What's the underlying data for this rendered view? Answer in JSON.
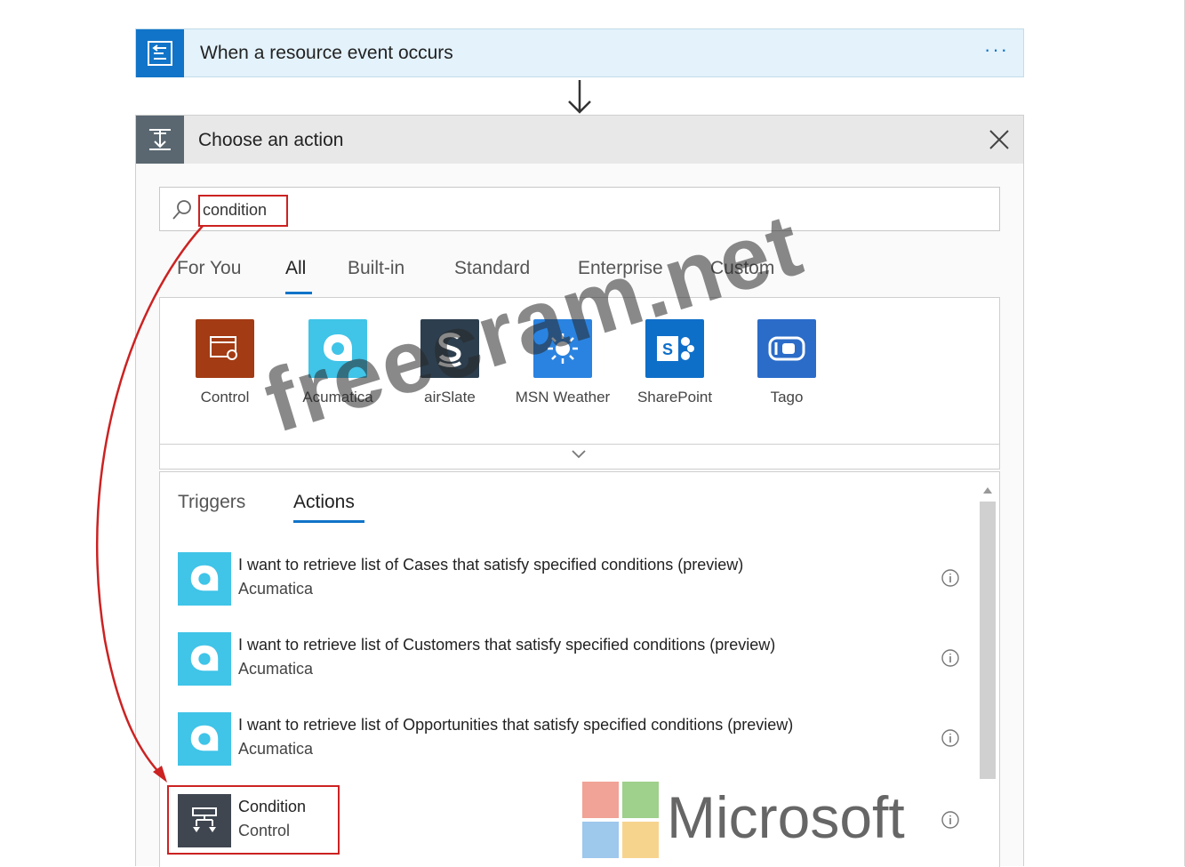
{
  "trigger": {
    "title": "When a resource event occurs",
    "more": "···"
  },
  "action_picker": {
    "title": "Choose an action",
    "search": {
      "value": "condition",
      "placeholder": ""
    },
    "category_tabs": [
      "For You",
      "All",
      "Built-in",
      "Standard",
      "Enterprise",
      "Custom"
    ],
    "active_category": "All",
    "connectors": [
      {
        "label": "Control",
        "color": "#a33b14",
        "icon": "control-icon"
      },
      {
        "label": "Acumatica",
        "color": "#40c4e8",
        "icon": "acumatica-icon"
      },
      {
        "label": "airSlate",
        "color": "#2d3f4e",
        "icon": "airslate-icon"
      },
      {
        "label": "MSN Weather",
        "color": "#2a83e0",
        "icon": "sun-icon"
      },
      {
        "label": "SharePoint",
        "color": "#0e6fc9",
        "icon": "sharepoint-icon"
      },
      {
        "label": "Tago",
        "color": "#2b6cc9",
        "icon": "tago-icon"
      }
    ],
    "result_tabs": [
      "Triggers",
      "Actions"
    ],
    "active_result_tab": "Actions",
    "results": [
      {
        "name": "I want to retrieve list of Cases that satisfy specified conditions (preview)",
        "connector": "Acumatica",
        "color": "#40c4e8"
      },
      {
        "name": "I want to retrieve list of Customers that satisfy specified conditions (preview)",
        "connector": "Acumatica",
        "color": "#40c4e8"
      },
      {
        "name": "I want to retrieve list of Opportunities that satisfy specified conditions (preview)",
        "connector": "Acumatica",
        "color": "#40c4e8"
      },
      {
        "name": "Condition",
        "connector": "Control",
        "color": "#3f4650"
      }
    ]
  },
  "overlays": {
    "watermark": "freecram.net",
    "microsoft": "Microsoft"
  },
  "colors": {
    "accent": "#1174c8",
    "highlight": "#cc2222"
  }
}
